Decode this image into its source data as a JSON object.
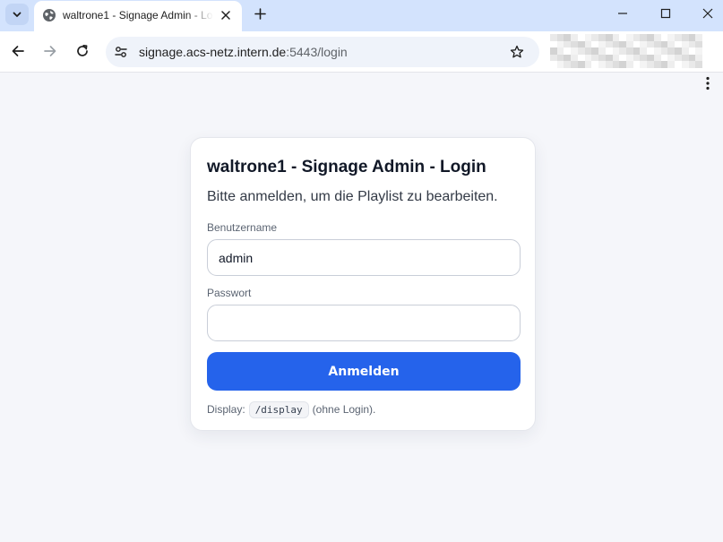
{
  "browser": {
    "tab_title": "waltrone1 - Signage Admin - Login",
    "url_host": "signage.acs-netz.intern.de",
    "url_rest": ":5443/login",
    "icons": {
      "tab_search": "chevron-down-icon",
      "favicon": "globe-icon",
      "close": "close-icon",
      "new_tab": "plus-icon",
      "minimize": "minimize-icon",
      "maximize": "maximize-icon",
      "window_close": "close-icon",
      "back": "arrow-left-icon",
      "forward": "arrow-right-icon",
      "reload": "reload-icon",
      "site_info": "tune-icon",
      "bookmark": "star-icon",
      "menu": "kebab-icon"
    }
  },
  "login": {
    "title": "waltrone1 - Signage Admin - Login",
    "subtitle": "Bitte anmelden, um die Playlist zu bearbeiten.",
    "username_label": "Benutzername",
    "username_value": "admin",
    "password_label": "Passwort",
    "password_value": "",
    "submit_label": "Anmelden",
    "footnote_prefix": "Display:",
    "footnote_code": "/display",
    "footnote_suffix": "(ohne Login)."
  },
  "colors": {
    "accent": "#2563eb",
    "page_background": "#f5f6fa",
    "tab_strip": "#d3e3fd"
  }
}
